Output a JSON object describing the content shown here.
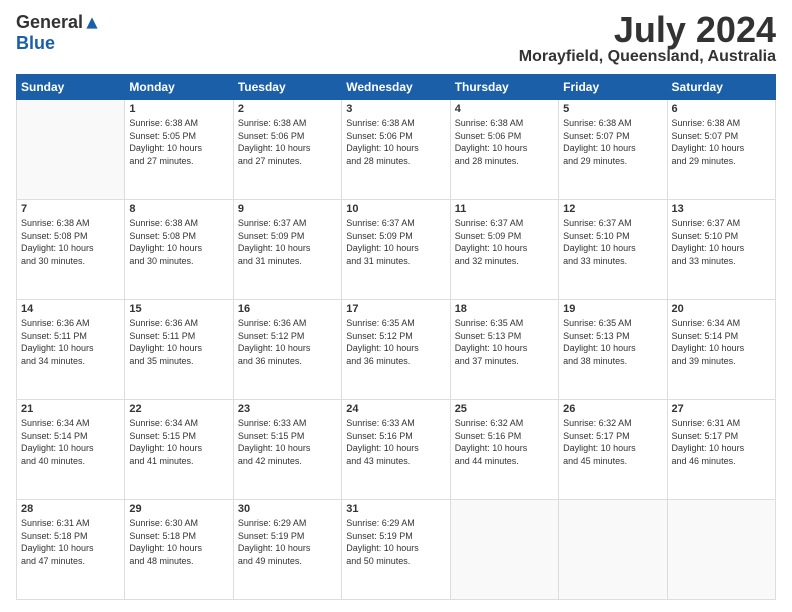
{
  "logo": {
    "general": "General",
    "blue": "Blue"
  },
  "title": "July 2024",
  "location": "Morayfield, Queensland, Australia",
  "days_of_week": [
    "Sunday",
    "Monday",
    "Tuesday",
    "Wednesday",
    "Thursday",
    "Friday",
    "Saturday"
  ],
  "weeks": [
    [
      {
        "day": "",
        "info": ""
      },
      {
        "day": "1",
        "info": "Sunrise: 6:38 AM\nSunset: 5:05 PM\nDaylight: 10 hours\nand 27 minutes."
      },
      {
        "day": "2",
        "info": "Sunrise: 6:38 AM\nSunset: 5:06 PM\nDaylight: 10 hours\nand 27 minutes."
      },
      {
        "day": "3",
        "info": "Sunrise: 6:38 AM\nSunset: 5:06 PM\nDaylight: 10 hours\nand 28 minutes."
      },
      {
        "day": "4",
        "info": "Sunrise: 6:38 AM\nSunset: 5:06 PM\nDaylight: 10 hours\nand 28 minutes."
      },
      {
        "day": "5",
        "info": "Sunrise: 6:38 AM\nSunset: 5:07 PM\nDaylight: 10 hours\nand 29 minutes."
      },
      {
        "day": "6",
        "info": "Sunrise: 6:38 AM\nSunset: 5:07 PM\nDaylight: 10 hours\nand 29 minutes."
      }
    ],
    [
      {
        "day": "7",
        "info": "Sunrise: 6:38 AM\nSunset: 5:08 PM\nDaylight: 10 hours\nand 30 minutes."
      },
      {
        "day": "8",
        "info": "Sunrise: 6:38 AM\nSunset: 5:08 PM\nDaylight: 10 hours\nand 30 minutes."
      },
      {
        "day": "9",
        "info": "Sunrise: 6:37 AM\nSunset: 5:09 PM\nDaylight: 10 hours\nand 31 minutes."
      },
      {
        "day": "10",
        "info": "Sunrise: 6:37 AM\nSunset: 5:09 PM\nDaylight: 10 hours\nand 31 minutes."
      },
      {
        "day": "11",
        "info": "Sunrise: 6:37 AM\nSunset: 5:09 PM\nDaylight: 10 hours\nand 32 minutes."
      },
      {
        "day": "12",
        "info": "Sunrise: 6:37 AM\nSunset: 5:10 PM\nDaylight: 10 hours\nand 33 minutes."
      },
      {
        "day": "13",
        "info": "Sunrise: 6:37 AM\nSunset: 5:10 PM\nDaylight: 10 hours\nand 33 minutes."
      }
    ],
    [
      {
        "day": "14",
        "info": "Sunrise: 6:36 AM\nSunset: 5:11 PM\nDaylight: 10 hours\nand 34 minutes."
      },
      {
        "day": "15",
        "info": "Sunrise: 6:36 AM\nSunset: 5:11 PM\nDaylight: 10 hours\nand 35 minutes."
      },
      {
        "day": "16",
        "info": "Sunrise: 6:36 AM\nSunset: 5:12 PM\nDaylight: 10 hours\nand 36 minutes."
      },
      {
        "day": "17",
        "info": "Sunrise: 6:35 AM\nSunset: 5:12 PM\nDaylight: 10 hours\nand 36 minutes."
      },
      {
        "day": "18",
        "info": "Sunrise: 6:35 AM\nSunset: 5:13 PM\nDaylight: 10 hours\nand 37 minutes."
      },
      {
        "day": "19",
        "info": "Sunrise: 6:35 AM\nSunset: 5:13 PM\nDaylight: 10 hours\nand 38 minutes."
      },
      {
        "day": "20",
        "info": "Sunrise: 6:34 AM\nSunset: 5:14 PM\nDaylight: 10 hours\nand 39 minutes."
      }
    ],
    [
      {
        "day": "21",
        "info": "Sunrise: 6:34 AM\nSunset: 5:14 PM\nDaylight: 10 hours\nand 40 minutes."
      },
      {
        "day": "22",
        "info": "Sunrise: 6:34 AM\nSunset: 5:15 PM\nDaylight: 10 hours\nand 41 minutes."
      },
      {
        "day": "23",
        "info": "Sunrise: 6:33 AM\nSunset: 5:15 PM\nDaylight: 10 hours\nand 42 minutes."
      },
      {
        "day": "24",
        "info": "Sunrise: 6:33 AM\nSunset: 5:16 PM\nDaylight: 10 hours\nand 43 minutes."
      },
      {
        "day": "25",
        "info": "Sunrise: 6:32 AM\nSunset: 5:16 PM\nDaylight: 10 hours\nand 44 minutes."
      },
      {
        "day": "26",
        "info": "Sunrise: 6:32 AM\nSunset: 5:17 PM\nDaylight: 10 hours\nand 45 minutes."
      },
      {
        "day": "27",
        "info": "Sunrise: 6:31 AM\nSunset: 5:17 PM\nDaylight: 10 hours\nand 46 minutes."
      }
    ],
    [
      {
        "day": "28",
        "info": "Sunrise: 6:31 AM\nSunset: 5:18 PM\nDaylight: 10 hours\nand 47 minutes."
      },
      {
        "day": "29",
        "info": "Sunrise: 6:30 AM\nSunset: 5:18 PM\nDaylight: 10 hours\nand 48 minutes."
      },
      {
        "day": "30",
        "info": "Sunrise: 6:29 AM\nSunset: 5:19 PM\nDaylight: 10 hours\nand 49 minutes."
      },
      {
        "day": "31",
        "info": "Sunrise: 6:29 AM\nSunset: 5:19 PM\nDaylight: 10 hours\nand 50 minutes."
      },
      {
        "day": "",
        "info": ""
      },
      {
        "day": "",
        "info": ""
      },
      {
        "day": "",
        "info": ""
      }
    ]
  ]
}
